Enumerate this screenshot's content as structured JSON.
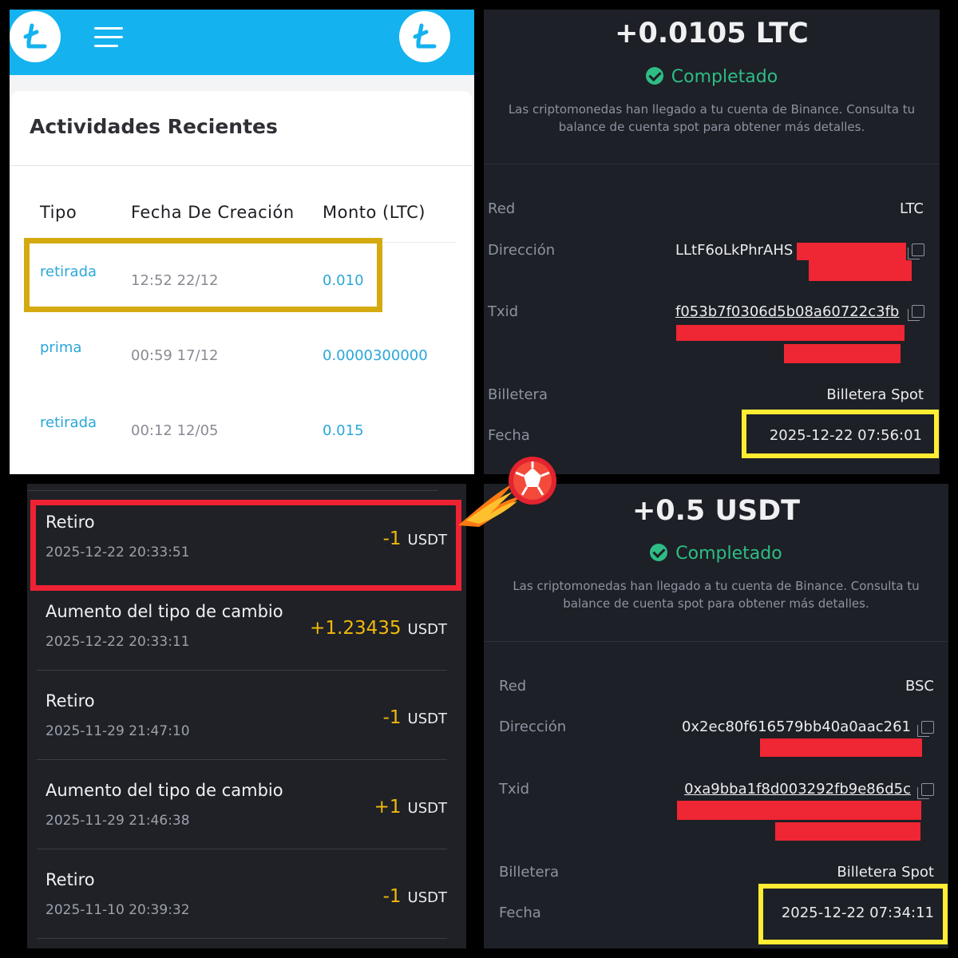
{
  "colors": {
    "faucet_blue": "#14b2ef",
    "link_blue": "#2aa7db",
    "success_green": "#2ebd85",
    "gold_highlight": "#d4aa10",
    "yellow_highlight": "#ffec33",
    "red_highlight": "#ee2233",
    "binance_yellow": "#f0b90b",
    "redaction_red": "#ef2633"
  },
  "faucet": {
    "logo_icon": "litecoin-logo-icon",
    "menu_icon": "hamburger-menu-icon",
    "title": "Actividades Recientes",
    "columns": [
      "Tipo",
      "Fecha De Creación",
      "Monto (LTC)"
    ],
    "rows": [
      {
        "type": "retirada",
        "date": "12:52 22/12",
        "amount": "0.010"
      },
      {
        "type": "prima",
        "date": "00:59 17/12",
        "amount": "0.0000300000"
      },
      {
        "type": "retirada",
        "date": "00:12 12/05",
        "amount": "0.015"
      }
    ]
  },
  "deposit_ltc": {
    "amount": "+0.0105 LTC",
    "status": "Completado",
    "desc_line1": "Las criptomonedas han llegado a tu cuenta de Binance. Consulta tu",
    "desc_line2": "balance de cuenta spot para obtener más detalles.",
    "network_label": "Red",
    "network": "LTC",
    "address_label": "Dirección",
    "address": "LLtF6oLkPhrAHS",
    "txid_label": "Txid",
    "txid": "f053b7f0306d5b08a60722c3fb",
    "wallet_label": "Billetera",
    "wallet": "Billetera Spot",
    "date_label": "Fecha",
    "date": "2025-12-22 07:56:01"
  },
  "history": {
    "unit": "USDT",
    "items": [
      {
        "title": "Retiro",
        "date": "2025-12-22 20:33:51",
        "amount": "-1"
      },
      {
        "title": "Aumento del tipo de cambio",
        "date": "2025-12-22 20:33:11",
        "amount": "+1.23435"
      },
      {
        "title": "Retiro",
        "date": "2025-11-29 21:47:10",
        "amount": "-1"
      },
      {
        "title": "Aumento del tipo de cambio",
        "date": "2025-11-29 21:46:38",
        "amount": "+1"
      },
      {
        "title": "Retiro",
        "date": "2025-11-10 20:39:32",
        "amount": "-1"
      }
    ]
  },
  "deposit_usdt": {
    "amount": "+0.5 USDT",
    "status": "Completado",
    "desc_line1": "Las criptomonedas han llegado a tu cuenta de Binance. Consulta tu",
    "desc_line2": "balance de cuenta spot para obtener más detalles.",
    "network_label": "Red",
    "network": "BSC",
    "address_label": "Dirección",
    "address": "0x2ec80f616579bb40a0aac261",
    "txid_label": "Txid",
    "txid": "0xa9bba1f8d003292fb9e86d5c",
    "wallet_label": "Billetera",
    "wallet": "Billetera Spot",
    "date_label": "Fecha",
    "date": "2025-12-22 07:34:11"
  },
  "decor": {
    "fireball_icon": "flaming-ball-icon"
  }
}
